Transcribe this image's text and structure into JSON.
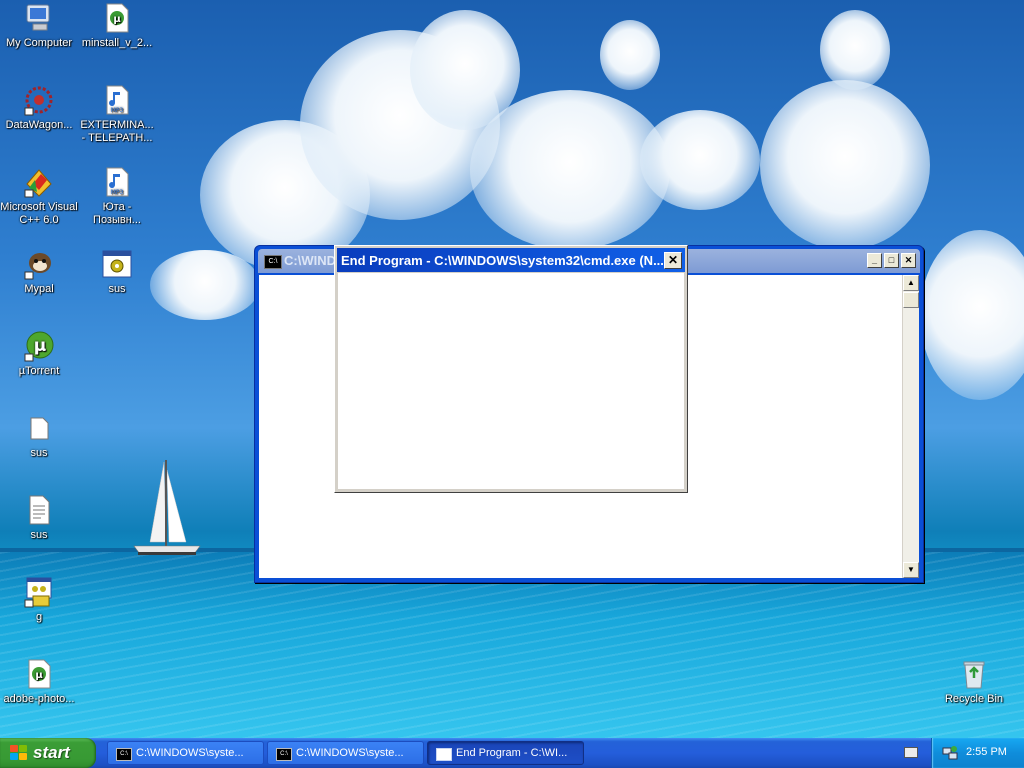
{
  "desktop": {
    "icons": [
      {
        "label": "My Computer",
        "icon": "my-computer-icon"
      },
      {
        "label": "minstall_v_2...",
        "icon": "utorrent-file-icon"
      },
      {
        "label": "DataWagon...",
        "icon": "datawagon-icon"
      },
      {
        "label": "EXTERMINA... - TELEPATH...",
        "icon": "mp3-file-icon",
        "badge": "MP3"
      },
      {
        "label": "Microsoft Visual C++ 6.0",
        "icon": "visual-cpp-icon"
      },
      {
        "label": "Юта - Позывн...",
        "icon": "mp3-file-icon",
        "badge": "MP3"
      },
      {
        "label": "Mypal",
        "icon": "mypal-icon"
      },
      {
        "label": "sus",
        "icon": "exe-app-icon"
      },
      {
        "label": "µTorrent",
        "icon": "utorrent-icon"
      },
      {
        "label": "sus",
        "icon": "blank-file-icon"
      },
      {
        "label": "sus",
        "icon": "text-file-icon"
      },
      {
        "label": "g",
        "icon": "batch-file-icon"
      },
      {
        "label": "adobe-photo...",
        "icon": "utorrent-file-icon"
      },
      {
        "label": "Recycle Bin",
        "icon": "recycle-bin-icon"
      }
    ]
  },
  "cmd_window": {
    "title": "C:\\WINDOWS\\system32\\cmd.exe",
    "title_icon": "C:\\",
    "buttons": {
      "minimize": "_",
      "maximize": "□",
      "close": "✕"
    }
  },
  "end_program_dialog": {
    "title": "End Program - C:\\WINDOWS\\system32\\cmd.exe (N...",
    "close_label": "✕"
  },
  "taskbar": {
    "start_label": "start",
    "buttons": [
      {
        "label": "C:\\WINDOWS\\syste...",
        "active": false
      },
      {
        "label": "C:\\WINDOWS\\syste...",
        "active": false
      },
      {
        "label": "End Program - C:\\WI...",
        "active": true
      }
    ],
    "clock": "2:55 PM"
  },
  "colors": {
    "taskbar_blue": "#245edb",
    "start_green": "#3a9d36",
    "tray_blue": "#0f8ddb",
    "active_title": "#0a3dbd",
    "inactive_title": "#9bb2de"
  }
}
